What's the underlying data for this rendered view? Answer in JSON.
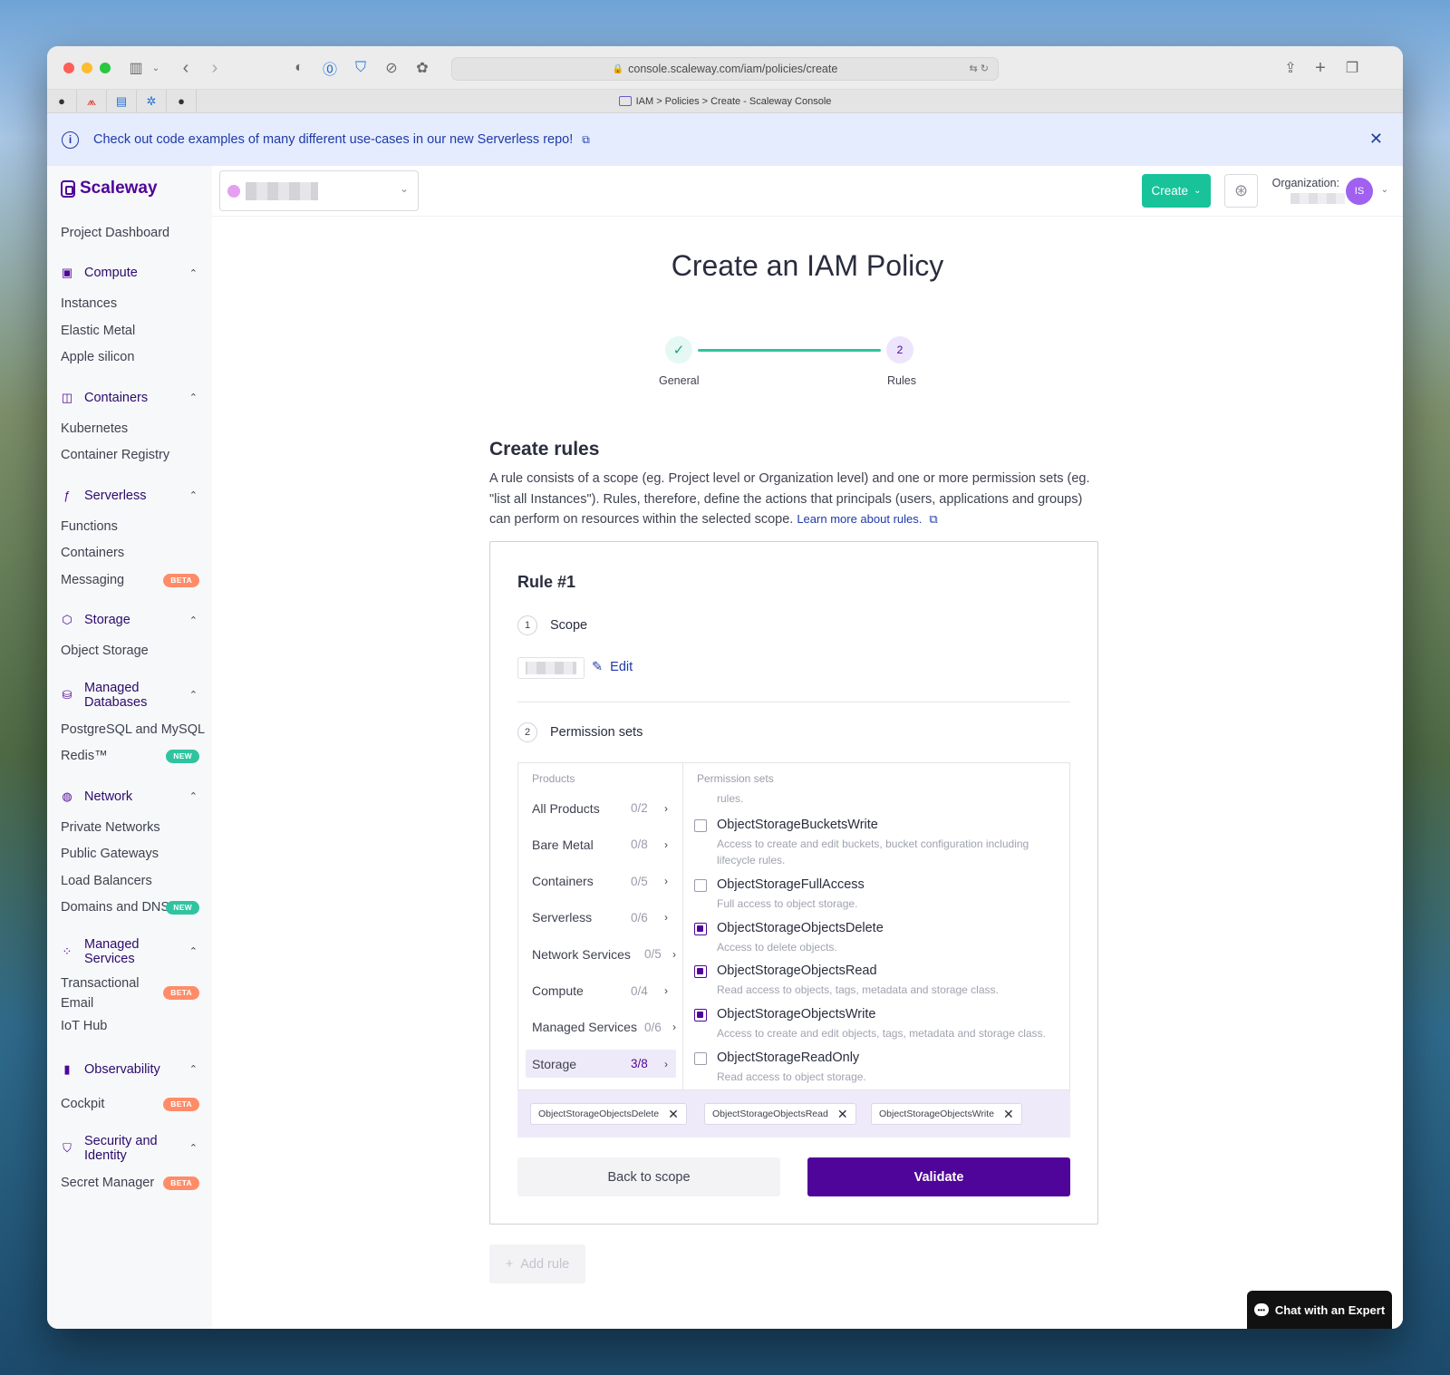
{
  "browser": {
    "url": "console.scaleway.com/iam/policies/create",
    "tab_title": "IAM > Policies > Create - Scaleway Console"
  },
  "banner": {
    "text": "Check out code examples of many different use-cases in our new Serverless repo!"
  },
  "sidebar": {
    "logo": "Scaleway",
    "project_dashboard": "Project Dashboard",
    "groups": [
      {
        "label": "Compute",
        "icon": "chip-icon",
        "items": [
          {
            "label": "Instances"
          },
          {
            "label": "Elastic Metal"
          },
          {
            "label": "Apple silicon"
          }
        ]
      },
      {
        "label": "Containers",
        "icon": "container-icon",
        "items": [
          {
            "label": "Kubernetes"
          },
          {
            "label": "Container Registry"
          }
        ]
      },
      {
        "label": "Serverless",
        "icon": "function-icon",
        "items": [
          {
            "label": "Functions"
          },
          {
            "label": "Containers"
          },
          {
            "label": "Messaging",
            "badge": "BETA"
          }
        ]
      },
      {
        "label": "Storage",
        "icon": "hexagon-icon",
        "items": [
          {
            "label": "Object Storage"
          }
        ]
      },
      {
        "label": "Managed Databases",
        "icon": "database-icon",
        "items": [
          {
            "label": "PostgreSQL and MySQL"
          },
          {
            "label": "Redis™",
            "badge": "NEW"
          }
        ]
      },
      {
        "label": "Network",
        "icon": "globe-icon",
        "items": [
          {
            "label": "Private Networks"
          },
          {
            "label": "Public Gateways"
          },
          {
            "label": "Load Balancers"
          },
          {
            "label": "Domains and DNS",
            "badge": "NEW"
          }
        ]
      },
      {
        "label": "Managed Services",
        "icon": "nodes-icon",
        "items": [
          {
            "label": "Transactional Email",
            "badge": "BETA"
          },
          {
            "label": "IoT Hub"
          }
        ]
      },
      {
        "label": "Observability",
        "icon": "bars-icon",
        "items": [
          {
            "label": "Cockpit",
            "badge": "BETA"
          }
        ]
      },
      {
        "label": "Security and Identity",
        "icon": "shield-icon",
        "items": [
          {
            "label": "Secret Manager",
            "badge": "BETA"
          }
        ]
      }
    ]
  },
  "topbar": {
    "create_label": "Create",
    "org_label": "Organization:",
    "avatar_initials": "IS"
  },
  "page": {
    "title": "Create an IAM Policy",
    "steps": [
      {
        "label": "General",
        "status": "done"
      },
      {
        "label": "Rules",
        "number": "2",
        "status": "current"
      }
    ],
    "section_title": "Create rules",
    "section_desc": "A rule consists of a scope (eg. Project level or Organization level) and one or more permission sets (eg. \"list all Instances\"). Rules, therefore, define the actions that principals (users, applications and groups) can perform on resources within the selected scope.",
    "learn_more": "Learn more about rules.",
    "rule": {
      "title": "Rule #1",
      "scope_num": "1",
      "scope_label": "Scope",
      "edit_label": "Edit",
      "perm_num": "2",
      "perm_label": "Permission sets",
      "products_head": "Products",
      "perms_head": "Permission sets",
      "rules_stub": "rules.",
      "products": [
        {
          "name": "All Products",
          "count": "0/2"
        },
        {
          "name": "Bare Metal",
          "count": "0/8"
        },
        {
          "name": "Containers",
          "count": "0/5"
        },
        {
          "name": "Serverless",
          "count": "0/6"
        },
        {
          "name": "Network Services",
          "count": "0/5"
        },
        {
          "name": "Compute",
          "count": "0/4"
        },
        {
          "name": "Managed Services",
          "count": "0/6"
        },
        {
          "name": "Storage",
          "count": "3/8",
          "active": true
        }
      ],
      "permissions": [
        {
          "name": "ObjectStorageBucketsWrite",
          "desc": "Access to create and edit buckets, bucket configuration including lifecycle rules.",
          "checked": false
        },
        {
          "name": "ObjectStorageFullAccess",
          "desc": "Full access to object storage.",
          "checked": false
        },
        {
          "name": "ObjectStorageObjectsDelete",
          "desc": "Access to delete objects.",
          "checked": true
        },
        {
          "name": "ObjectStorageObjectsRead",
          "desc": "Read access to objects, tags, metadata and storage class.",
          "checked": true
        },
        {
          "name": "ObjectStorageObjectsWrite",
          "desc": "Access to create and edit objects, tags, metadata and storage class.",
          "checked": true
        },
        {
          "name": "ObjectStorageReadOnly",
          "desc": "Read access to object storage.",
          "checked": false
        }
      ],
      "selected": [
        "ObjectStorageObjectsDelete",
        "ObjectStorageObjectsRead",
        "ObjectStorageObjectsWrite"
      ],
      "back_label": "Back to scope",
      "validate_label": "Validate"
    },
    "add_rule_label": "Add rule",
    "chat_label": "Chat with an Expert"
  },
  "colors": {
    "brand": "#4f0599",
    "accent_green": "#18c39a",
    "banner_bg": "#e5ecfd",
    "beta_badge": "#ff8c69",
    "new_badge": "#2fc4a0"
  }
}
